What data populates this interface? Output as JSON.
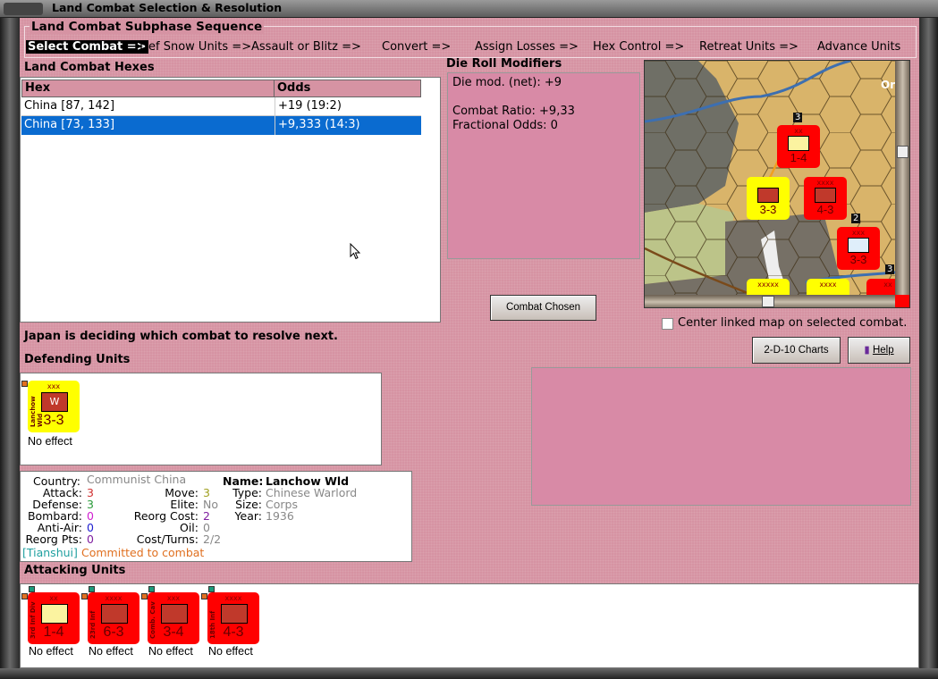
{
  "window": {
    "title": "Land Combat Selection & Resolution"
  },
  "sequence": {
    "title": "Land Combat Subphase Sequence",
    "steps": [
      "Select Combat =>",
      "Def Snow Units =>",
      "Assault or Blitz =>",
      "Convert =>",
      "Assign Losses =>",
      "Hex Control =>",
      "Retreat Units =>",
      "Advance Units"
    ]
  },
  "hexes": {
    "label": "Land Combat Hexes",
    "columns": [
      "Hex",
      "Odds"
    ],
    "rows": [
      {
        "hex": "China [87, 142]",
        "odds": "+19 (19:2)"
      },
      {
        "hex": "China [73, 133]",
        "odds": "+9,333 (14:3)",
        "selected": true
      }
    ]
  },
  "die": {
    "label": "Die Roll Modifiers",
    "line1": "Die mod. (net): +9",
    "line2": "Combat Ratio: +9,33",
    "line3": "Fractional Odds: 0"
  },
  "buttons": {
    "combat_chosen": "Combat Chosen",
    "charts": "2-D-10 Charts",
    "help": "Help"
  },
  "center_checkbox": {
    "label": "Center linked map on selected combat.",
    "checked": false
  },
  "status": "Japan is deciding which combat to resolve next.",
  "map": {
    "place_label": "Ord",
    "stack_counts": [
      "3",
      "2",
      "3"
    ],
    "units": [
      {
        "size": "xx",
        "value": "1-4"
      },
      {
        "size": "xxxx",
        "value": "4-3"
      },
      {
        "size": "xxx",
        "value": "3-3"
      },
      {
        "size": "xxx",
        "value": "3-3"
      },
      {
        "size": "xxxxx",
        "value": ""
      },
      {
        "size": "xxxx",
        "value": ""
      },
      {
        "size": "xx",
        "value": ""
      }
    ]
  },
  "defending": {
    "label": "Defending Units",
    "units": [
      {
        "name": "Lanchow Wld",
        "size": "xxx",
        "symbol": "W",
        "value": "3-3",
        "result": "No effect"
      }
    ]
  },
  "info": {
    "country_label": "Country:",
    "country": "Communist China",
    "attack_label": "Attack:",
    "attack": "3",
    "defense_label": "Defense:",
    "defense": "3",
    "bombard_label": "Bombard:",
    "bombard": "0",
    "antiair_label": "Anti-Air:",
    "antiair": "0",
    "reorgpts_label": "Reorg Pts:",
    "reorgpts": "0",
    "move_label": "Move:",
    "move": "3",
    "elite_label": "Elite:",
    "elite": "No",
    "reorgcost_label": "Reorg Cost:",
    "reorgcost": "2",
    "oil_label": "Oil:",
    "oil": "0",
    "costturns_label": "Cost/Turns:",
    "costturns": "2/2",
    "name_label": "Name:",
    "name": "Lanchow Wld",
    "type_label": "Type:",
    "type": "Chinese Warlord",
    "size_label": "Size:",
    "size": "Corps",
    "year_label": "Year:",
    "year": "1936",
    "location": "[Tianshui]",
    "status": "Committed to combat"
  },
  "attacking": {
    "label": "Attacking Units",
    "units": [
      {
        "name": "3rd Inf Div",
        "size": "xx",
        "value": "1-4",
        "result": "No effect",
        "light": true
      },
      {
        "name": "23rd Inf",
        "size": "xxxx",
        "value": "6-3",
        "result": "No effect"
      },
      {
        "name": "Comb. Cav",
        "size": "xxx",
        "value": "3-4",
        "result": "No effect"
      },
      {
        "name": "18th Inf",
        "size": "xxxx",
        "value": "4-3",
        "result": "No effect"
      }
    ]
  },
  "colors": {
    "attack": "#d03030",
    "defense": "#2a9a3a",
    "bombard": "#d020d0",
    "antiair": "#2020d0",
    "move": "#a0a020",
    "reorgcost": "#8020a0",
    "location": "#20a0a0",
    "status": "#e07020"
  }
}
